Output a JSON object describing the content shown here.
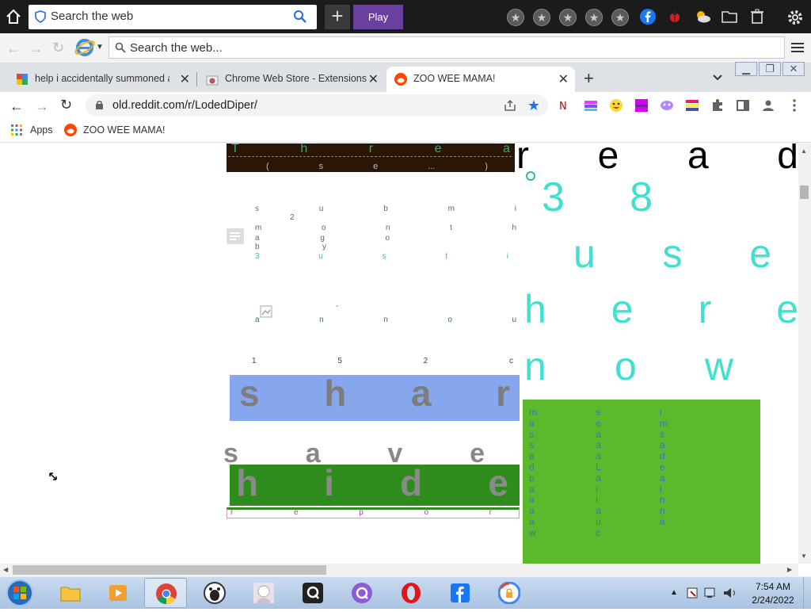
{
  "outer_toolbar": {
    "search_placeholder": "Search the web",
    "plus_label": "+",
    "play_label": "Play"
  },
  "nav_bar": {
    "search_placeholder": "Search the web..."
  },
  "tabs": [
    {
      "label": "help i accidentally summoned a",
      "icon": "google-icon",
      "active": false
    },
    {
      "label": "Chrome Web Store - Extensions",
      "icon": "chrome-web-store-icon",
      "active": false
    },
    {
      "label": "ZOO WEE MAMA!",
      "icon": "reddit-icon",
      "active": true
    }
  ],
  "new_tab_label": "+",
  "address_bar": {
    "url": "old.reddit.com/r/LodedDiper/"
  },
  "bookmarks": [
    {
      "label": "Apps",
      "icon": "apps-grid-icon"
    },
    {
      "label": "ZOO WEE MAMA!",
      "icon": "reddit-icon"
    }
  ],
  "page": {
    "thread_title": "T h r e a",
    "thread_meta": "( s e ... )",
    "read_line": "r e a d",
    "user_count": "3 8",
    "users_word": "u s e",
    "here_word": "h e r e",
    "now_word": "n o w",
    "submitted": "s u b m i",
    "submitted_2": "2",
    "months": "m o n t h",
    "maybe": "a g o",
    "by": "b y",
    "username": "3 u s t i",
    "image_dash": "-",
    "anon_line": "a n n o u",
    "count_line": "1 5 2 c",
    "share_label": "s h a r",
    "save_label": "s a v e",
    "hide_label": "h i d e",
    "report_label": "r e p o r",
    "green_box_col1": "m a s s a d b a a a a w",
    "green_box_col2": "s e a a a L a i i a u c",
    "green_box_col3": "i m s a d e a i n n a"
  },
  "taskbar": {
    "time": "7:54 AM",
    "date": "2/24/2022",
    "apps": [
      "explorer-icon",
      "media-player-icon",
      "chrome-icon",
      "discord-like-icon",
      "anime-character-icon",
      "q-app-icon",
      "q-circle-app-icon",
      "opera-icon",
      "facebook-icon",
      "lock-browser-icon"
    ]
  },
  "colors": {
    "thread_banner": "#2a1606",
    "cyan_text": "#40e0d0",
    "share_box": "#86a7ee",
    "hide_box": "#2d8c1b",
    "green_box": "#5cb82c",
    "play_button": "#6a3fa0"
  }
}
